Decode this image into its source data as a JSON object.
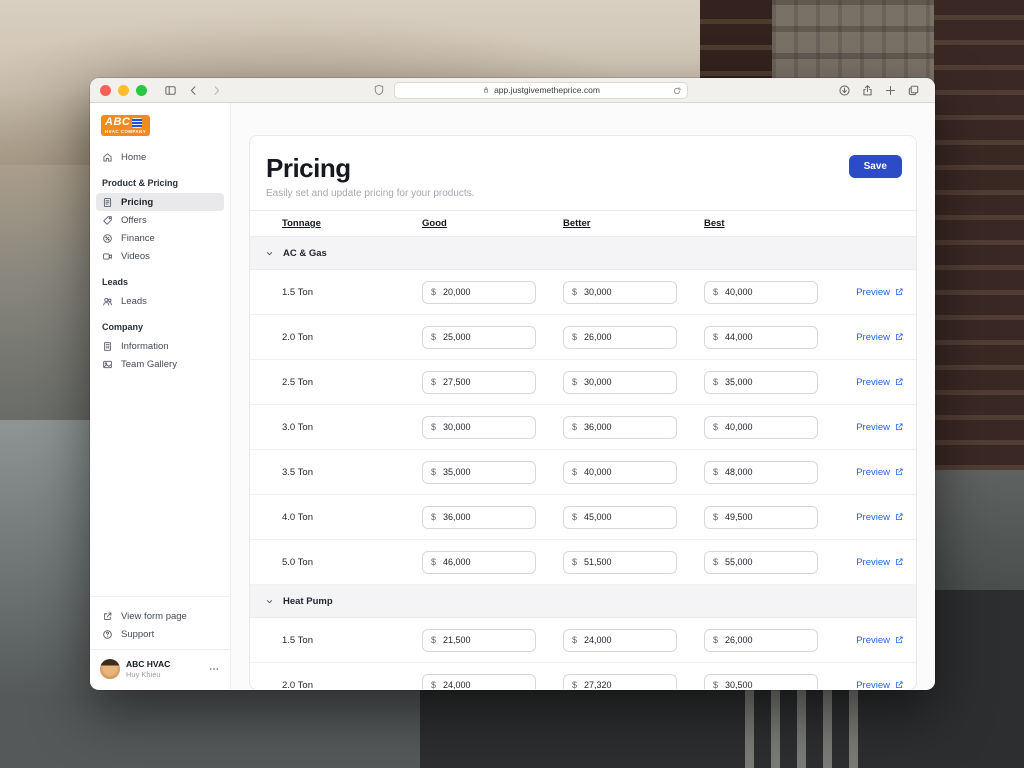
{
  "browser": {
    "url": "app.justgivemetheprice.com",
    "window_controls": [
      "close",
      "minimize",
      "zoom"
    ],
    "chrome_icons": [
      "sidebar-toggle-icon",
      "back-icon",
      "forward-icon",
      "shield-icon",
      "lock-icon",
      "reload-icon",
      "downloads-icon",
      "share-icon",
      "new-tab-icon",
      "tab-overview-icon"
    ]
  },
  "sidebar": {
    "logo": {
      "abc": "ABC",
      "company": "HVAC COMPANY"
    },
    "sections": [
      {
        "label": "",
        "items": [
          {
            "label": "Home",
            "icon": "home-icon",
            "active": false
          }
        ]
      },
      {
        "label": "Product & Pricing",
        "items": [
          {
            "label": "Pricing",
            "icon": "pricing-icon",
            "active": true
          },
          {
            "label": "Offers",
            "icon": "offers-icon",
            "active": false
          },
          {
            "label": "Finance",
            "icon": "finance-icon",
            "active": false
          },
          {
            "label": "Videos",
            "icon": "videos-icon",
            "active": false
          }
        ]
      },
      {
        "label": "Leads",
        "items": [
          {
            "label": "Leads",
            "icon": "leads-icon",
            "active": false
          }
        ]
      },
      {
        "label": "Company",
        "items": [
          {
            "label": "Information",
            "icon": "information-icon",
            "active": false
          },
          {
            "label": "Team Gallery",
            "icon": "gallery-icon",
            "active": false
          }
        ]
      }
    ],
    "footer_items": [
      {
        "label": "View form page",
        "icon": "external-link-icon"
      },
      {
        "label": "Support",
        "icon": "help-icon"
      }
    ],
    "profile": {
      "name": "ABC HVAC",
      "subtitle": "Huy Khieu"
    }
  },
  "main": {
    "title": "Pricing",
    "subtitle": "Easily set and update pricing for your products.",
    "save_label": "Save",
    "table": {
      "columns": [
        "Tonnage",
        "Good",
        "Better",
        "Best"
      ],
      "currency": "$",
      "preview_label": "Preview",
      "groups": [
        {
          "name": "AC & Gas",
          "rows": [
            {
              "tonnage": "1.5 Ton",
              "good": "20,000",
              "better": "30,000",
              "best": "40,000"
            },
            {
              "tonnage": "2.0 Ton",
              "good": "25,000",
              "better": "26,000",
              "best": "44,000"
            },
            {
              "tonnage": "2.5 Ton",
              "good": "27,500",
              "better": "30,000",
              "best": "35,000"
            },
            {
              "tonnage": "3.0 Ton",
              "good": "30,000",
              "better": "36,000",
              "best": "40,000"
            },
            {
              "tonnage": "3.5 Ton",
              "good": "35,000",
              "better": "40,000",
              "best": "48,000"
            },
            {
              "tonnage": "4.0 Ton",
              "good": "36,000",
              "better": "45,000",
              "best": "49,500"
            },
            {
              "tonnage": "5.0 Ton",
              "good": "46,000",
              "better": "51,500",
              "best": "55,000"
            }
          ]
        },
        {
          "name": "Heat Pump",
          "rows": [
            {
              "tonnage": "1.5 Ton",
              "good": "21,500",
              "better": "24,000",
              "best": "26,000"
            },
            {
              "tonnage": "2.0 Ton",
              "good": "24,000",
              "better": "27,320",
              "best": "30,500"
            }
          ]
        }
      ]
    }
  },
  "colors": {
    "accent_blue": "#2b4bc7",
    "link_blue": "#2563eb",
    "logo_orange": "#f28a1e",
    "logo_blue": "#1f4fd8",
    "traffic_red": "#ff5f57",
    "traffic_yellow": "#febc2e",
    "traffic_green": "#28c840",
    "group_row_bg": "#f4f4f6"
  }
}
